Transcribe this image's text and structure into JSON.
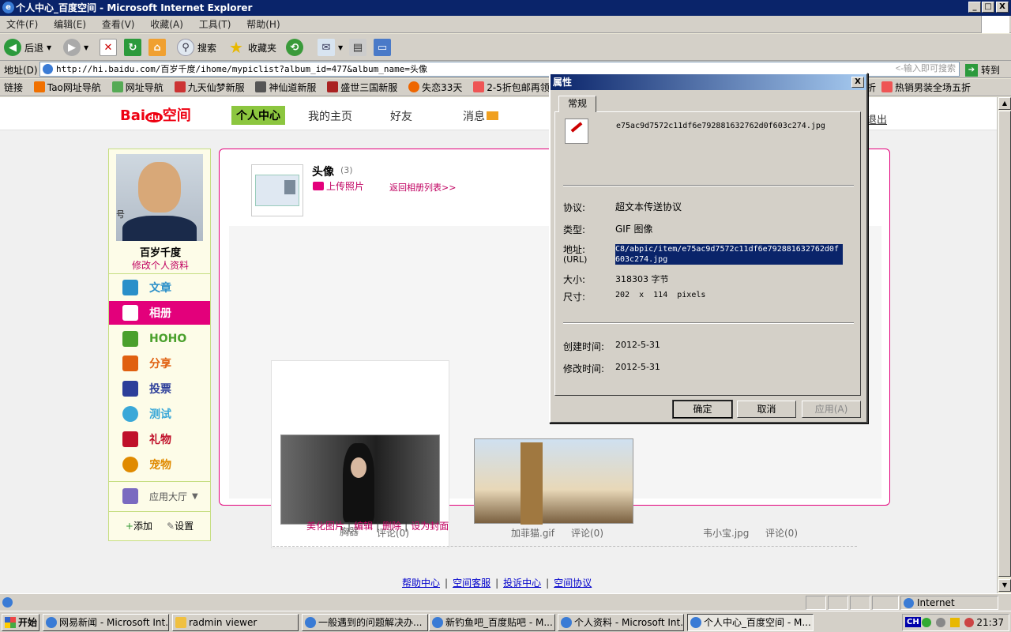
{
  "window": {
    "title": "个人中心_百度空间 - Microsoft Internet Explorer",
    "minimize": "_",
    "maximize": "□",
    "close": "X"
  },
  "menu": [
    "文件(F)",
    "编辑(E)",
    "查看(V)",
    "收藏(A)",
    "工具(T)",
    "帮助(H)"
  ],
  "toolbar": {
    "back": "后退",
    "search": "搜索",
    "favorites": "收藏夹"
  },
  "address": {
    "label": "地址(D)",
    "url": "http://hi.baidu.com/百岁千度/ihome/mypiclist?album_id=477&album_name=头像",
    "hint": "<-输入即可搜索",
    "go": "转到"
  },
  "links": {
    "label": "链接",
    "items": [
      "Tao网址导航",
      "网址导航",
      "九天仙梦新服",
      "神仙道新服",
      "盛世三国新服",
      "失恋33天",
      "2-5折包邮再领2",
      "折",
      "热销男装全场五折"
    ]
  },
  "site": {
    "logo_bai": "Bai",
    "logo_du": "du",
    "logo_space": "空间",
    "nav": [
      "个人中心",
      "我的主页",
      "好友",
      "消息"
    ],
    "logout": "退出"
  },
  "sidebar": {
    "avatar_caption": "号",
    "username": "百岁千度",
    "edit_profile": "修改个人资料",
    "items": [
      {
        "label": "文章",
        "icon": "article-icon",
        "color": "#2a8fc9"
      },
      {
        "label": "相册",
        "icon": "album-icon",
        "color": "#ffffff"
      },
      {
        "label": "HOHO",
        "icon": "hoho-icon",
        "color": "#4aa02c"
      },
      {
        "label": "分享",
        "icon": "share-icon",
        "color": "#e06010"
      },
      {
        "label": "投票",
        "icon": "vote-icon",
        "color": "#2c3e9a"
      },
      {
        "label": "测试",
        "icon": "test-icon",
        "color": "#3aa8d8"
      },
      {
        "label": "礼物",
        "icon": "gift-icon",
        "color": "#c0102a"
      },
      {
        "label": "宠物",
        "icon": "pet-icon",
        "color": "#e08a00"
      }
    ],
    "app_hall": "应用大厅",
    "add": "添加",
    "settings": "设置"
  },
  "album": {
    "title": "头像",
    "count": "(3)",
    "upload": "上传照片",
    "back_to_list": "返回相册列表>>",
    "photos": [
      {
        "name": "胸器",
        "comments": "评论(0)"
      },
      {
        "name": "加菲猫.gif",
        "comments": "评论(0)"
      },
      {
        "name": "韦小宝.jpg",
        "comments": "评论(0)"
      }
    ],
    "actions": [
      "美化图片",
      "编辑",
      "删除",
      "设为封面"
    ]
  },
  "footer": [
    "帮助中心",
    "空间客服",
    "投诉中心",
    "空间协议"
  ],
  "dialog": {
    "title": "属性",
    "close": "X",
    "tab": "常规",
    "filename": "e75ac9d7572c11df6e792881632762d0f603c274.jpg",
    "protocol_label": "协议:",
    "protocol": "超文本传送协议",
    "type_label": "类型:",
    "type": "GIF 图像",
    "address_label": "地址:",
    "address_label2": "(URL)",
    "address": "C8/abpic/item/e75ac9d7572c11df6e792881632762d0f603c274.jpg",
    "size_label": "大小:",
    "size": "318303 字节",
    "dimensions_label": "尺寸:",
    "dimensions": "202  x  114  pixels",
    "created_label": "创建时间:",
    "created": "2012-5-31",
    "modified_label": "修改时间:",
    "modified": "2012-5-31",
    "ok": "确定",
    "cancel": "取消",
    "apply": "应用(A)"
  },
  "statusbar": {
    "zone": "Internet"
  },
  "taskbar": {
    "start": "开始",
    "tasks": [
      "网易新闻 - Microsoft Int...",
      "radmin viewer",
      "一般遇到的问题解决办...",
      "新钓鱼吧_百度贴吧 - M...",
      "个人资料 - Microsoft Int...",
      "个人中心_百度空间 - M..."
    ],
    "ime": "CH",
    "clock": "21:37"
  }
}
